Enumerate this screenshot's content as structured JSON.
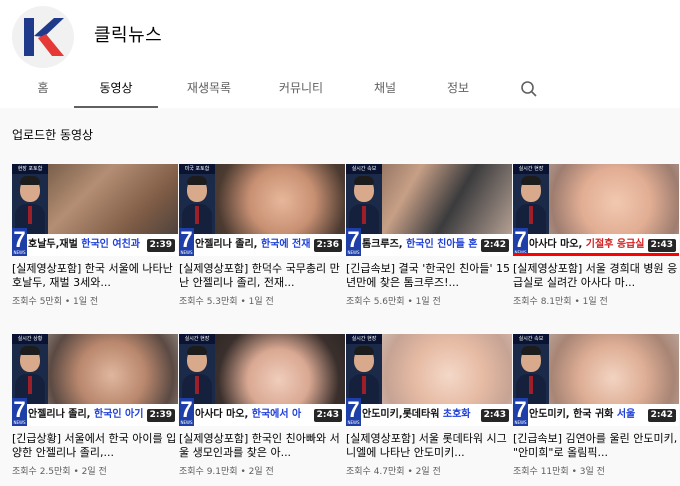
{
  "channel": {
    "name": "클릭뉴스",
    "logo_letter": "K"
  },
  "tabs": [
    {
      "label": "홈",
      "active": false
    },
    {
      "label": "동영상",
      "active": true
    },
    {
      "label": "재생목록",
      "active": false
    },
    {
      "label": "커뮤니티",
      "active": false
    },
    {
      "label": "채널",
      "active": false
    },
    {
      "label": "정보",
      "active": false
    }
  ],
  "section_title": "업로드한 동영상",
  "videos": [
    {
      "tag": "현장 포토합",
      "banner": "호날두,재벌 ",
      "banner_hl": "한국인 여친과",
      "duration": "2:39",
      "title": "[실제영상포함] 한국 서울에 나타난 호날두, 재벌 3세와...",
      "views": "조회수 5만회",
      "date": "1일 전"
    },
    {
      "tag": "미국 포토합",
      "banner": "안젤리나 졸리, ",
      "banner_hl": "한국에 전재",
      "duration": "2:36",
      "title": "[실제영상포함] 한덕수 국무총리 만난 안젤리나 졸리, 전재...",
      "views": "조회수 5.3만회",
      "date": "1일 전"
    },
    {
      "tag": "실시간 속보",
      "banner": "톰크루즈, ",
      "banner_hl": "한국인 친아들 혼",
      "duration": "2:42",
      "title": "[긴급속보] 결국 '한국인 친아들' 15년만에 찾은 톰크루즈!...",
      "views": "조회수 5.6만회",
      "date": "1일 전"
    },
    {
      "tag": "실시간 현장",
      "banner": "아사다 마오, ",
      "banner_hl": "기절후 응급실",
      "duration": "2:43",
      "title": "[실제영상포함] 서울 경희대 병원 응급실로 실려간 아사다 마...",
      "views": "조회수 8.1만회",
      "date": "1일 전"
    },
    {
      "tag": "실시간 상황",
      "banner": "안젤리나 졸리, ",
      "banner_hl": "한국인 아기",
      "duration": "2:39",
      "title": "[긴급상황] 서울에서 한국 아이를 입양한 안젤리나 졸리,...",
      "views": "조회수 2.5만회",
      "date": "2일 전"
    },
    {
      "tag": "실시간 현장",
      "banner": "아사다 마오, ",
      "banner_hl": "한국에서 아",
      "duration": "2:43",
      "title": "[실제영상포함] 한국인 친아빠와 서울 생모인과를 찾은 아...",
      "views": "조회수 9.1만회",
      "date": "2일 전"
    },
    {
      "tag": "실시간 현장",
      "banner": "안도미키,롯데타워 ",
      "banner_hl": "초호화",
      "duration": "2:43",
      "title": "[실제영상포함] 서울 롯데타워 시그니엘에 나타난 안도미키...",
      "views": "조회수 4.7만회",
      "date": "2일 전"
    },
    {
      "tag": "실시간 속보",
      "banner": "안도미키, 한국 귀화 ",
      "banner_hl": "서울",
      "duration": "2:42",
      "title": "[긴급속보] 김연아를 울린 안도미키, \"안미희\"로 올림픽...",
      "views": "조회수 11만회",
      "date": "3일 전"
    }
  ],
  "colors": {
    "accent_blue": "#1e40d8",
    "accent_red": "#d12121",
    "news_blue": "#1f3fa8",
    "progress": "#ff0000"
  },
  "icons": {
    "search": "search-icon",
    "seven_logo": "7",
    "seven_sub": "NEWS"
  }
}
